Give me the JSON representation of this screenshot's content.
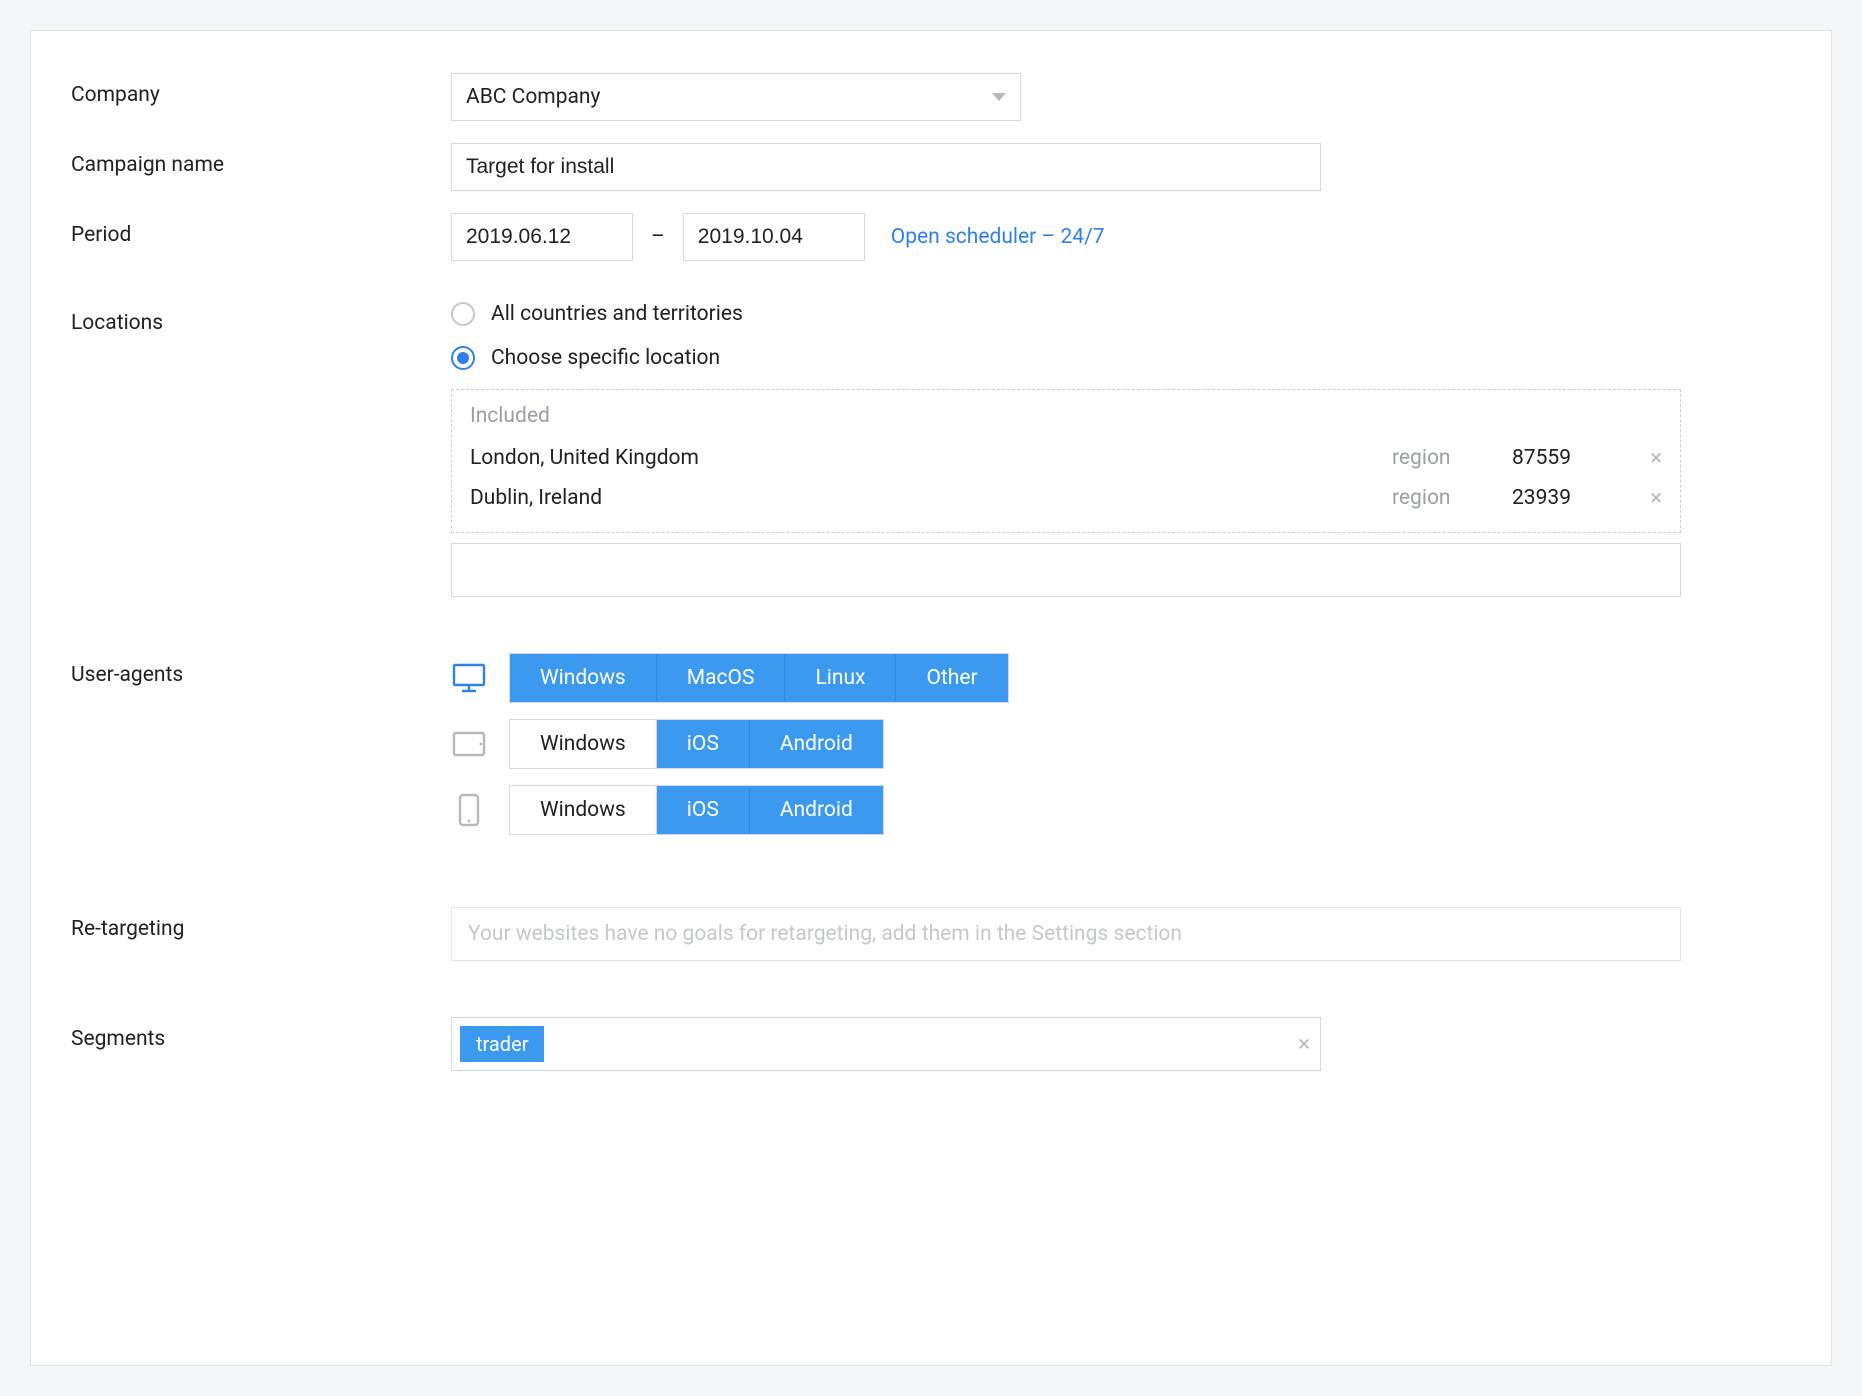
{
  "labels": {
    "company": "Company",
    "campaign": "Campaign name",
    "period": "Period",
    "locations": "Locations",
    "ua": "User-agents",
    "retargeting": "Re-targeting",
    "segments": "Segments"
  },
  "company": {
    "value": "ABC Company"
  },
  "campaign": {
    "value": "Target for install"
  },
  "period": {
    "from": "2019.06.12",
    "to": "2019.10.04",
    "dash": "–",
    "scheduler_link": "Open scheduler – 24/7"
  },
  "locations": {
    "opt_all": "All countries and territories",
    "opt_specific": "Choose specific location",
    "selected": "specific",
    "included_label": "Included",
    "region_label": "region",
    "items": [
      {
        "name": "London, United Kingdom",
        "count": "87559"
      },
      {
        "name": "Dublin, Ireland",
        "count": "23939"
      }
    ]
  },
  "ua": {
    "desktop": [
      "Windows",
      "MacOS",
      "Linux",
      "Other"
    ],
    "desktop_sel": [
      true,
      true,
      true,
      true
    ],
    "tablet": [
      "Windows",
      "iOS",
      "Android"
    ],
    "tablet_sel": [
      false,
      true,
      true
    ],
    "mobile": [
      "Windows",
      "iOS",
      "Android"
    ],
    "mobile_sel": [
      false,
      true,
      true
    ]
  },
  "retargeting": {
    "placeholder": "Your websites have no goals for retargeting, add them in the Settings section"
  },
  "segments": {
    "tags": [
      "trader"
    ]
  }
}
